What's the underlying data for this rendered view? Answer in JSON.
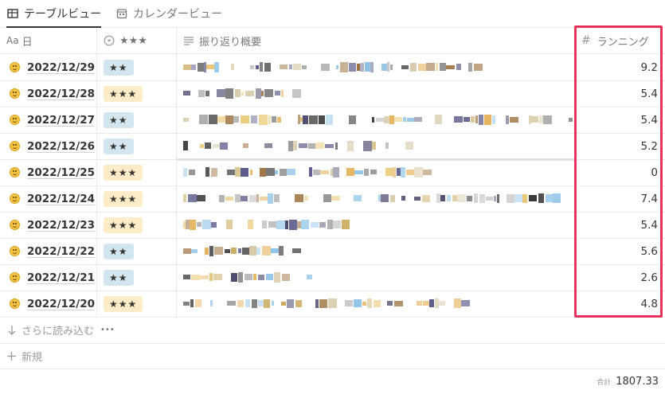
{
  "tabs": [
    {
      "label": "テーブルビュー",
      "icon": "table-icon",
      "active": true
    },
    {
      "label": "カレンダービュー",
      "icon": "calendar-icon",
      "active": false
    }
  ],
  "columns": {
    "date": {
      "prefix": "Aa",
      "label": "日"
    },
    "rating": {
      "label": "★★★"
    },
    "review": {
      "label": "振り返り概要"
    },
    "running": {
      "label": "ランニング"
    }
  },
  "rows": [
    {
      "date": "2022/12/29",
      "rating": "★★",
      "running": "9.2"
    },
    {
      "date": "2022/12/28",
      "rating": "★★★",
      "running": "5.4"
    },
    {
      "date": "2022/12/27",
      "rating": "★★",
      "running": "5.4"
    },
    {
      "date": "2022/12/26",
      "rating": "★★",
      "running": "5.2"
    },
    {
      "date": "2022/12/25",
      "rating": "★★★",
      "running": "0"
    },
    {
      "date": "2022/12/24",
      "rating": "★★★",
      "running": "7.4"
    },
    {
      "date": "2022/12/23",
      "rating": "★★★",
      "running": "5.4"
    },
    {
      "date": "2022/12/22",
      "rating": "★★",
      "running": "5.6"
    },
    {
      "date": "2022/12/21",
      "rating": "★★",
      "running": "2.6"
    },
    {
      "date": "2022/12/20",
      "rating": "★★★",
      "running": "4.8"
    }
  ],
  "load_more": {
    "label": "さらに読み込む",
    "menu": "•••"
  },
  "new_row": {
    "label": "新規"
  },
  "footer": {
    "sum_label": "合計",
    "sum_value": "1807.33"
  },
  "colors": {
    "highlight": "#e8325a",
    "tag_two": "#d3e5ef",
    "tag_three": "#fdecc8"
  }
}
